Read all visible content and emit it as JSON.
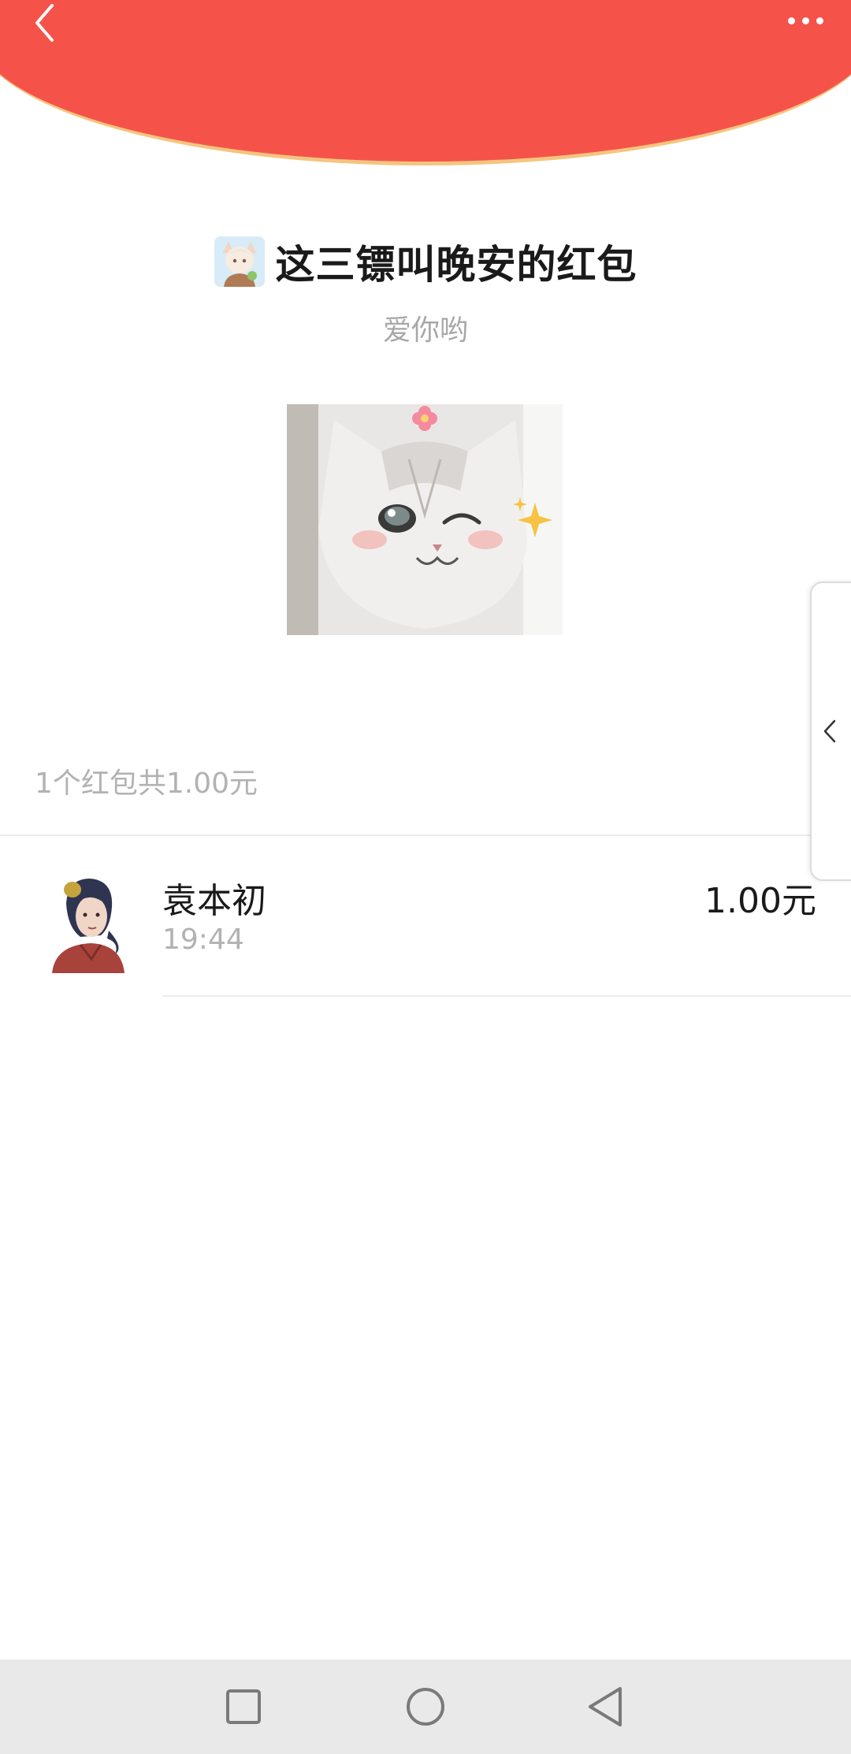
{
  "header": {
    "back_icon": "chevron-left-icon",
    "more_icon": "more-dots-icon",
    "accent_color": "#f5534a"
  },
  "packet": {
    "sender_title": "这三镖叫晚安的红包",
    "greeting": "爱你哟",
    "summary": "1个红包共1.00元"
  },
  "records": [
    {
      "name": "袁本初",
      "time": "19:44",
      "amount": "1.00元"
    }
  ],
  "side_tab": {
    "icon": "chevron-left-icon"
  },
  "navbar": {
    "icons": [
      "recents-square-icon",
      "home-circle-icon",
      "back-triangle-icon"
    ]
  }
}
